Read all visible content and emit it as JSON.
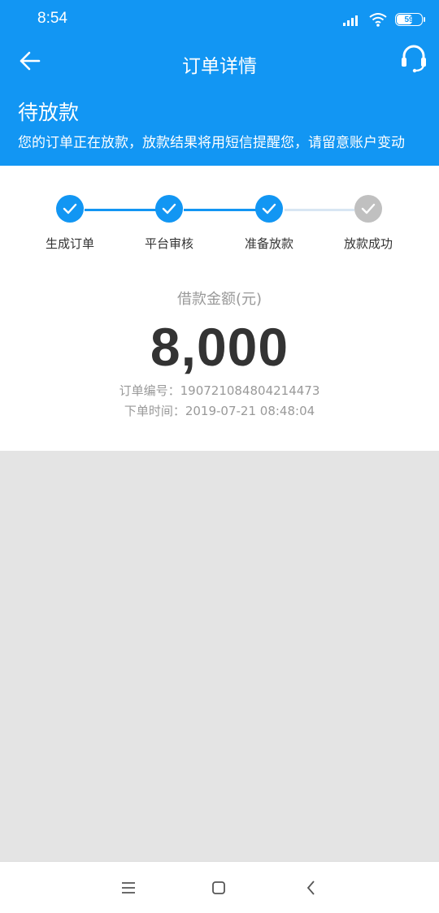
{
  "status_bar": {
    "time": "8:54",
    "battery": "59",
    "icons": [
      "signal-icon",
      "wifi-icon",
      "battery-icon"
    ]
  },
  "header": {
    "title": "订单详情",
    "back_icon": "back-arrow-icon",
    "service_icon": "headset-icon"
  },
  "notice": {
    "headline": "待放款",
    "description": "您的订单正在放款，放款结果将用短信提醒您，请留意账户变动"
  },
  "progress": {
    "steps": [
      {
        "label": "生成订单",
        "done": true
      },
      {
        "label": "平台审核",
        "done": true
      },
      {
        "label": "准备放款",
        "done": true
      },
      {
        "label": "放款成功",
        "done": false
      }
    ]
  },
  "loan": {
    "amount_label": "借款金额(元)",
    "amount": "8,000",
    "order_no_label": "订单编号：",
    "order_no": "190721084804214473",
    "order_time_label": "下单时间：",
    "order_time": "2019-07-21 08:48:04"
  },
  "colors": {
    "accent": "#1296f3",
    "step_pending": "#c0c0c0",
    "line_pending": "#d8e6f3"
  }
}
